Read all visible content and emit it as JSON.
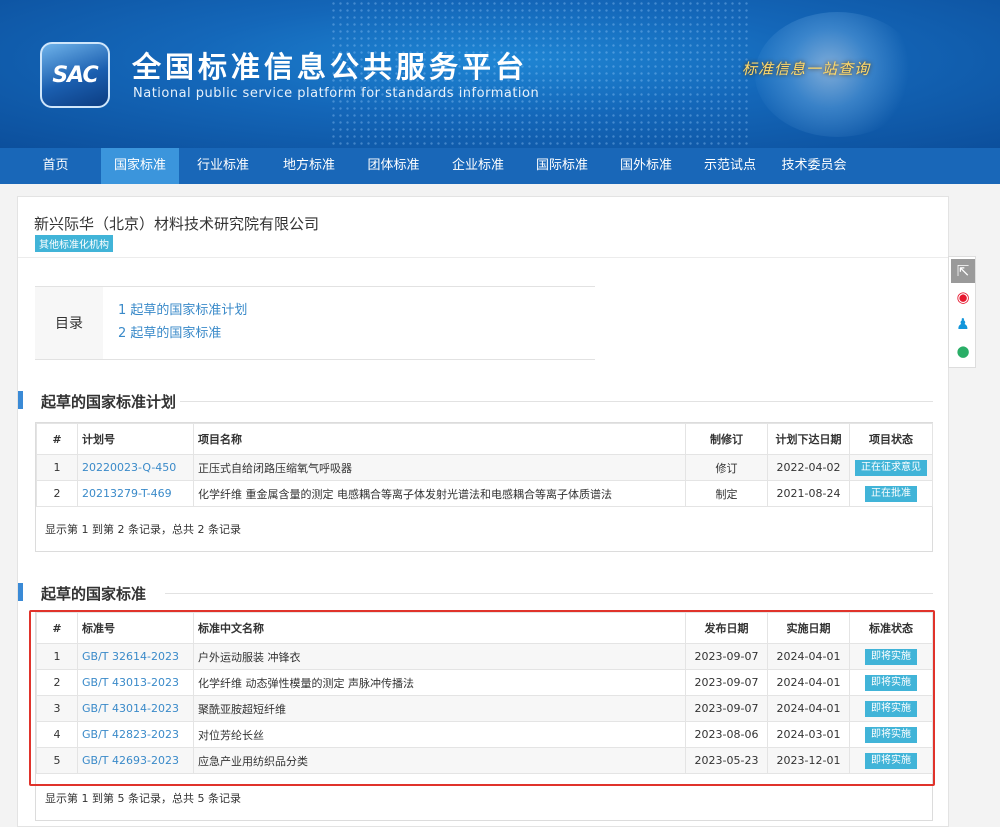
{
  "header": {
    "logo_text": "SAC",
    "title": "全国标准信息公共服务平台",
    "subtitle": "National public service platform  for standards information",
    "slogan": "标准信息一站查询"
  },
  "nav": [
    {
      "label": "首页"
    },
    {
      "label": "国家标准",
      "active": true
    },
    {
      "label": "行业标准"
    },
    {
      "label": "地方标准"
    },
    {
      "label": "团体标准"
    },
    {
      "label": "企业标准"
    },
    {
      "label": "国际标准"
    },
    {
      "label": "国外标准"
    },
    {
      "label": "示范试点"
    },
    {
      "label": "技术委员会"
    }
  ],
  "org": {
    "name": "新兴际华（北京）材料技术研究院有限公司",
    "badge": "其他标准化机构"
  },
  "toc": {
    "title": "目录",
    "items": [
      "1  起草的国家标准计划",
      "2  起草的国家标准"
    ]
  },
  "plans": {
    "title": "起草的国家标准计划",
    "headers": [
      "#",
      "计划号",
      "项目名称",
      "制修订",
      "计划下达日期",
      "项目状态"
    ],
    "rows": [
      {
        "n": "1",
        "code": "20220023-Q-450",
        "name": "正压式自给闭路压缩氧气呼吸器",
        "type": "修订",
        "date": "2022-04-02",
        "status": "正在征求意见"
      },
      {
        "n": "2",
        "code": "20213279-T-469",
        "name": "化学纤维 重金属含量的测定 电感耦合等离子体发射光谱法和电感耦合等离子体质谱法",
        "type": "制定",
        "date": "2021-08-24",
        "status": "正在批准"
      }
    ],
    "summary": "显示第 1 到第 2 条记录，总共 2 条记录"
  },
  "standards": {
    "title": "起草的国家标准",
    "headers": [
      "#",
      "标准号",
      "标准中文名称",
      "发布日期",
      "实施日期",
      "标准状态"
    ],
    "rows": [
      {
        "n": "1",
        "code": "GB/T 32614-2023",
        "name": "户外运动服装 冲锋衣",
        "pub": "2023-09-07",
        "impl": "2024-04-01",
        "status": "即将实施"
      },
      {
        "n": "2",
        "code": "GB/T 43013-2023",
        "name": "化学纤维 动态弹性模量的测定 声脉冲传播法",
        "pub": "2023-09-07",
        "impl": "2024-04-01",
        "status": "即将实施"
      },
      {
        "n": "3",
        "code": "GB/T 43014-2023",
        "name": "聚酰亚胺超短纤维",
        "pub": "2023-09-07",
        "impl": "2024-04-01",
        "status": "即将实施"
      },
      {
        "n": "4",
        "code": "GB/T 42823-2023",
        "name": "对位芳纶长丝",
        "pub": "2023-08-06",
        "impl": "2024-03-01",
        "status": "即将实施"
      },
      {
        "n": "5",
        "code": "GB/T 42693-2023",
        "name": "应急产业用纺织品分类",
        "pub": "2023-05-23",
        "impl": "2023-12-01",
        "status": "即将实施"
      }
    ],
    "summary": "显示第 1 到第 5 条记录，总共 5 条记录"
  },
  "share": [
    {
      "icon": "share-icon",
      "glyph": "⇱",
      "color": "#ffffff"
    },
    {
      "icon": "weibo-icon",
      "glyph": "◉",
      "color": "#e6162d"
    },
    {
      "icon": "qq-icon",
      "glyph": "♟",
      "color": "#1296db"
    },
    {
      "icon": "wechat-icon",
      "glyph": "●",
      "color": "#2aae67"
    }
  ]
}
